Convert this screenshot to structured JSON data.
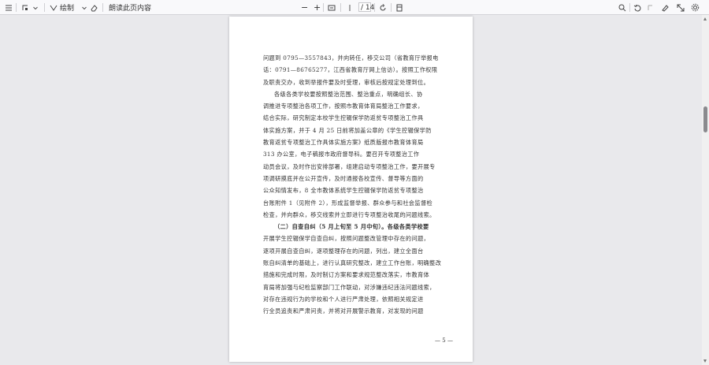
{
  "toolbar": {
    "sidebar_toggle_icon": "sidebar-icon",
    "highlight_label": "",
    "draw_label": "绘制",
    "eraser_icon": "eraser-icon",
    "read_aloud_label": "朗读此页内容",
    "zoom_out_label": "−",
    "zoom_in_label": "+",
    "fit_icon": "fit-page-icon",
    "page_current": "",
    "page_total": "/ 14",
    "rotate_icon": "rotate-icon",
    "page_view_icon": "page-view-icon",
    "search_icon": "search-icon",
    "undo_icon": "undo-icon",
    "redo_icon": "redo-icon",
    "pen_icon": "pen-icon",
    "save_icon": "save-icon",
    "expand_icon": "expand-icon",
    "settings_icon": "gear-icon"
  },
  "document": {
    "lines": [
      {
        "text": "问题到 0795—3557843，并向转任，移交公司（省教育厅举报电",
        "indent": false
      },
      {
        "text": "话：0791—86765277，江西省教育厅网上信访）。按照工作权限",
        "indent": false
      },
      {
        "text": "及职责交办，收到举报件要及时受理，审核后按规定处理到位。",
        "indent": false
      },
      {
        "text": "各级各类学校要按照整治范围、整治重点，明确组长、协",
        "indent": true
      },
      {
        "text": "调推进专项整治各项工作，按照市教育体育局整治工作要求，",
        "indent": false
      },
      {
        "text": "结合实际，研究制定本校学生控辍保学防返贫专项整治工作具",
        "indent": false
      },
      {
        "text": "体实施方案，并于 4 月 25 日前将加盖公章的《学生控辍保学防",
        "indent": false
      },
      {
        "text": "教育返贫专项整治工作具体实施方案》纸质版报市教育体育局",
        "indent": false
      },
      {
        "text": "313 办公室，电子稿报市政府督导科。要召开专项整治工作",
        "indent": false
      },
      {
        "text": "动员会议，及时作出安排部署，组建启动专项整治工作，要开展专",
        "indent": false
      },
      {
        "text": "项调研摸底并在公开宣传，及时通报各校宣传、督导等方面的",
        "indent": false
      },
      {
        "text": "公众知情发布，8 全市教体系统学生控辍保学防返贫专项整治",
        "indent": false
      },
      {
        "text": "台账附件 1（见附件 2），形成监督举报、群众参与和社会监督检",
        "indent": false
      },
      {
        "text": "检查，并向群众，移交线索并立即进行专项整治收尾的问题线索。",
        "indent": false
      },
      {
        "text": "（二）自查自纠（5 月上旬至 5 月中旬）。各级各类学校要",
        "indent": true,
        "bold_prefix": true
      },
      {
        "text": "开展学生控辍保学自查自纠，按照问题整改管理中存在的问题，",
        "indent": false
      },
      {
        "text": "逐项开展自查自纠，逐项整理存在的问题，列出，建立全面台",
        "indent": false
      },
      {
        "text": "账自纠清单的基础上，进行认真研究整改，建立工作台账，明确整改",
        "indent": false
      },
      {
        "text": "措施和完成时限，及时制订方案和要求规范整改落实，市教育体",
        "indent": false
      },
      {
        "text": "育局将加强与纪检监察部门工作联动，对涉嫌违纪违法问题线索，",
        "indent": false
      },
      {
        "text": "对存在违规行为的学校和个人进行严肃处理，依照相关规定进",
        "indent": false
      },
      {
        "text": "行全员追责和严肃问责，并将对开展警示教育，对发现的问题",
        "indent": false
      }
    ],
    "page_number": "— 5 —"
  },
  "colors": {
    "toolbar_bg": "#f9f9fb",
    "viewer_bg": "#e9e9ec",
    "page_bg": "#ffffff",
    "scroll_thumb": "#8a8a8e"
  }
}
